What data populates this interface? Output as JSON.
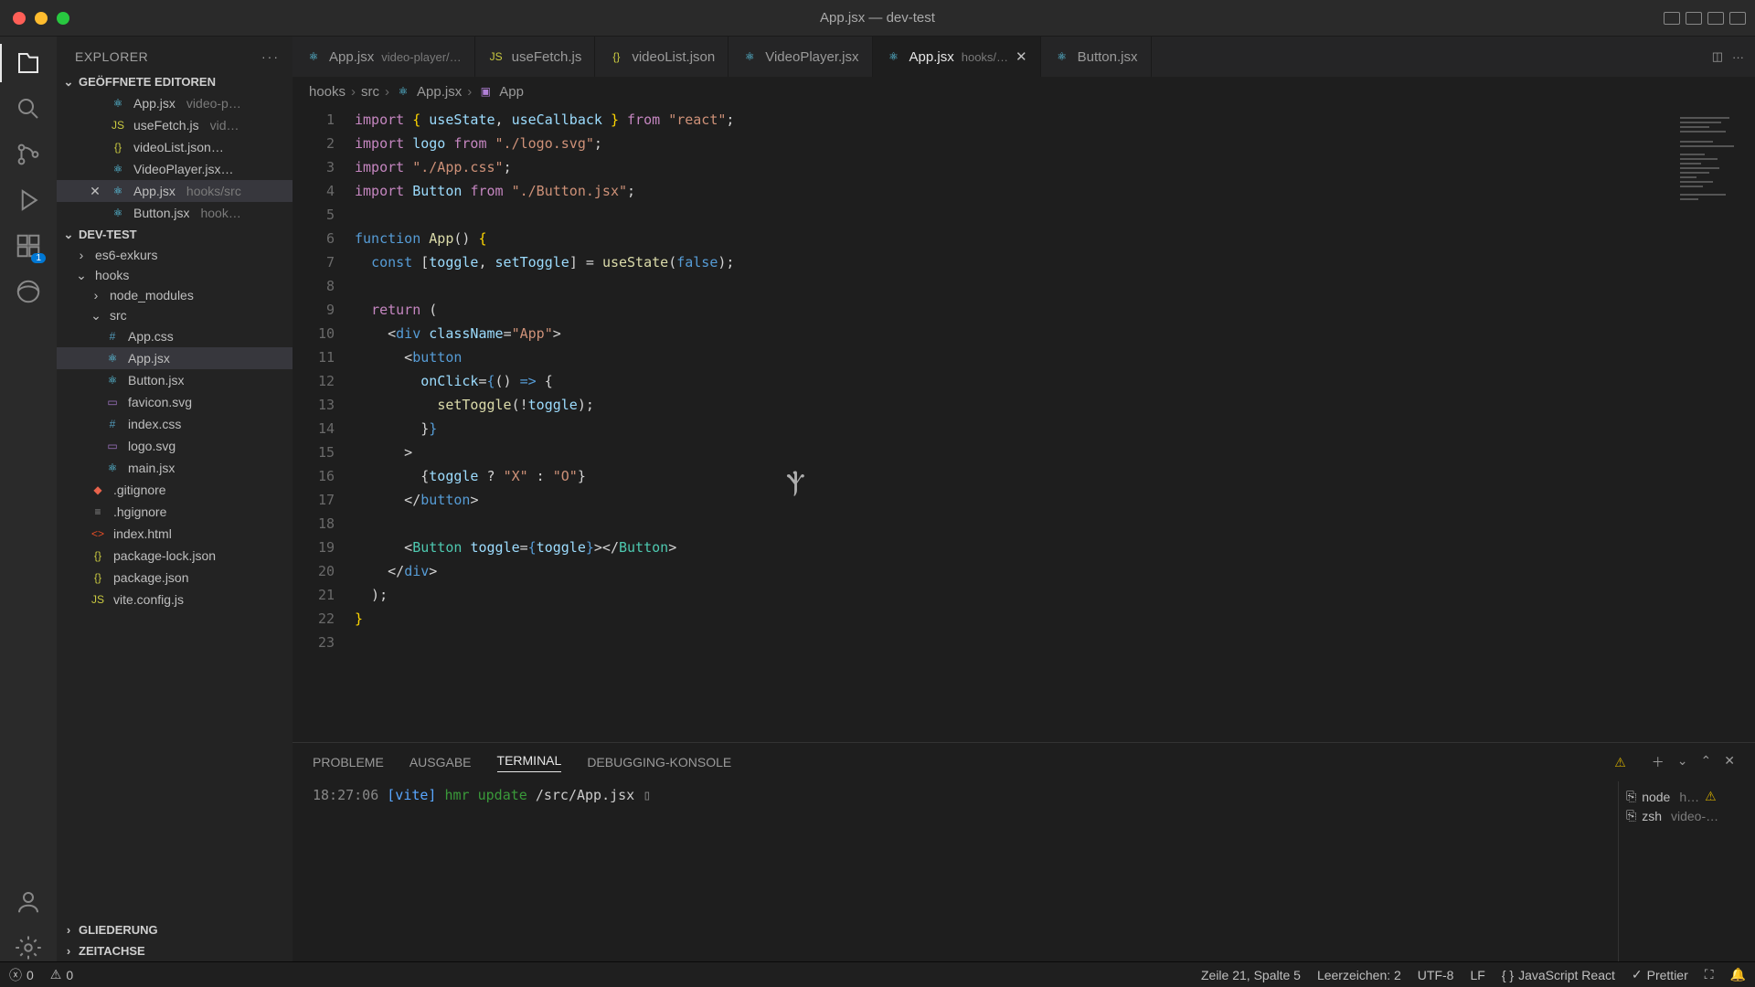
{
  "title": "App.jsx — dev-test",
  "sidebar": {
    "title": "EXPLORER",
    "sections": {
      "openEditors": "GEÖFFNETE EDITOREN",
      "project": "DEV-TEST",
      "outline": "GLIEDERUNG",
      "timeline": "ZEITACHSE"
    },
    "openEditors": [
      {
        "name": "App.jsx",
        "desc": "video-p…",
        "icon": "react"
      },
      {
        "name": "useFetch.js",
        "desc": "vid…",
        "icon": "js"
      },
      {
        "name": "videoList.json…",
        "desc": "",
        "icon": "json"
      },
      {
        "name": "VideoPlayer.jsx…",
        "desc": "",
        "icon": "react"
      },
      {
        "name": "App.jsx",
        "desc": "hooks/src",
        "icon": "react",
        "active": true
      },
      {
        "name": "Button.jsx",
        "desc": "hook…",
        "icon": "react"
      }
    ],
    "tree": [
      {
        "name": "es6-exkurs",
        "kind": "folder",
        "indent": 1
      },
      {
        "name": "hooks",
        "kind": "folder-open",
        "indent": 1
      },
      {
        "name": "node_modules",
        "kind": "folder",
        "indent": 2
      },
      {
        "name": "src",
        "kind": "folder-open",
        "indent": 2
      },
      {
        "name": "App.css",
        "kind": "file",
        "icon": "css",
        "indent": 3
      },
      {
        "name": "App.jsx",
        "kind": "file",
        "icon": "react",
        "indent": 3,
        "selected": true
      },
      {
        "name": "Button.jsx",
        "kind": "file",
        "icon": "react",
        "indent": 3
      },
      {
        "name": "favicon.svg",
        "kind": "file",
        "icon": "svg",
        "indent": 3
      },
      {
        "name": "index.css",
        "kind": "file",
        "icon": "css",
        "indent": 3
      },
      {
        "name": "logo.svg",
        "kind": "file",
        "icon": "svg",
        "indent": 3
      },
      {
        "name": "main.jsx",
        "kind": "file",
        "icon": "react",
        "indent": 3
      },
      {
        "name": ".gitignore",
        "kind": "file",
        "icon": "git",
        "indent": 2
      },
      {
        "name": ".hgignore",
        "kind": "file",
        "icon": "text",
        "indent": 2
      },
      {
        "name": "index.html",
        "kind": "file",
        "icon": "html",
        "indent": 2
      },
      {
        "name": "package-lock.json",
        "kind": "file",
        "icon": "json",
        "indent": 2
      },
      {
        "name": "package.json",
        "kind": "file",
        "icon": "json",
        "indent": 2
      },
      {
        "name": "vite.config.js",
        "kind": "file",
        "icon": "js",
        "indent": 2
      }
    ]
  },
  "tabs": [
    {
      "name": "App.jsx",
      "desc": "video-player/…",
      "icon": "react"
    },
    {
      "name": "useFetch.js",
      "icon": "js"
    },
    {
      "name": "videoList.json",
      "icon": "json"
    },
    {
      "name": "VideoPlayer.jsx",
      "icon": "react"
    },
    {
      "name": "App.jsx",
      "desc": "hooks/…",
      "icon": "react",
      "active": true,
      "close": true
    },
    {
      "name": "Button.jsx",
      "icon": "react"
    }
  ],
  "breadcrumb": [
    "hooks",
    "src",
    "App.jsx",
    "App"
  ],
  "terminalTabs": {
    "problems": "PROBLEME",
    "output": "AUSGABE",
    "terminal": "TERMINAL",
    "debug": "DEBUGGING-KONSOLE"
  },
  "terminalLine": {
    "time": "18:27:06",
    "tag": "[vite]",
    "msg": "hmr update",
    "path": "/src/App.jsx"
  },
  "terminalProcesses": [
    {
      "name": "node",
      "desc": "h…",
      "warn": true
    },
    {
      "name": "zsh",
      "desc": "video-…"
    }
  ],
  "status": {
    "errors": "0",
    "warnings": "0",
    "position": "Zeile 21, Spalte 5",
    "spaces": "Leerzeichen: 2",
    "encoding": "UTF-8",
    "eol": "LF",
    "lang": "JavaScript React",
    "prettier": "Prettier"
  },
  "code": {
    "lines": 23
  }
}
